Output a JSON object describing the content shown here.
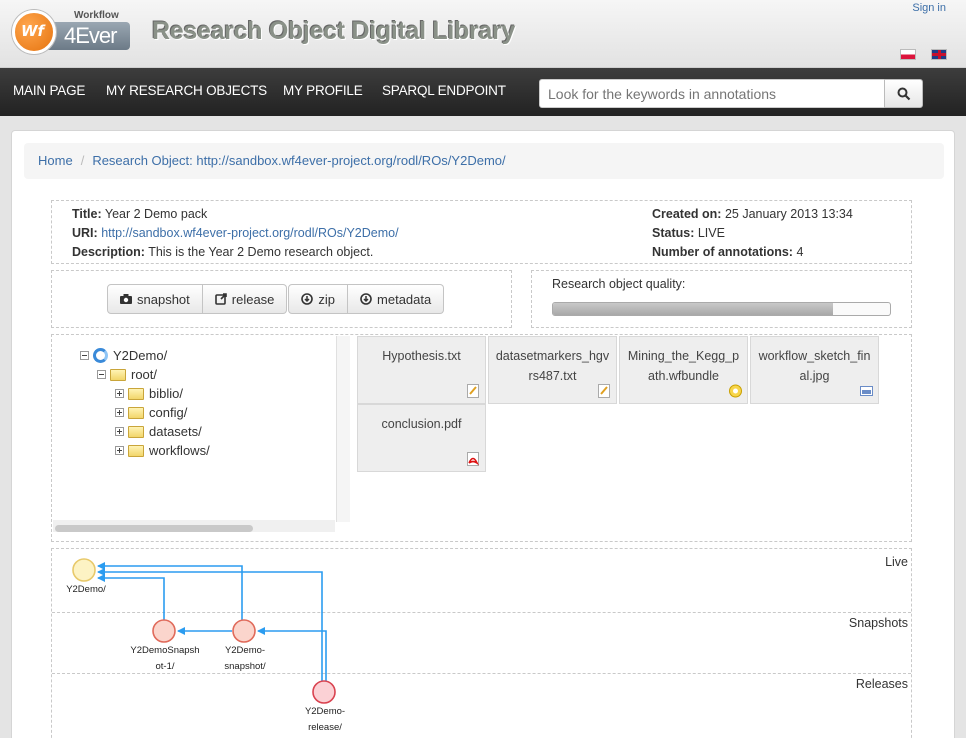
{
  "header": {
    "logo_workflow": "Workflow",
    "logo_wf": "Wf",
    "logo_4ever": "4Ever",
    "site_title": "Research Object Digital Library",
    "sign_in": "Sign in"
  },
  "nav": {
    "items": [
      "MAIN PAGE",
      "MY RESEARCH OBJECTS",
      "MY PROFILE",
      "SPARQL ENDPOINT"
    ],
    "search_placeholder": "Look for the keywords in annotations"
  },
  "breadcrumb": {
    "home": "Home",
    "current": "Research Object: http://sandbox.wf4ever-project.org/rodl/ROs/Y2Demo/"
  },
  "ro": {
    "title_label": "Title:",
    "title": "Year 2 Demo pack",
    "uri_label": "URI:",
    "uri": "http://sandbox.wf4ever-project.org/rodl/ROs/Y2Demo/",
    "description_label": "Description:",
    "description": "This is the Year 2 Demo research object.",
    "created_label": "Created on:",
    "created": "25 January 2013 13:34",
    "status_label": "Status:",
    "status": "LIVE",
    "annotations_label": "Number of annotations:",
    "annotations": "4"
  },
  "actions": {
    "snapshot": "snapshot",
    "release": "release",
    "zip": "zip",
    "metadata": "metadata"
  },
  "quality": {
    "label": "Research object quality:",
    "value_pct": 83
  },
  "tree": {
    "root": "Y2Demo/",
    "child": "root/",
    "folders": [
      "biblio/",
      "config/",
      "datasets/",
      "workflows/"
    ]
  },
  "files": [
    {
      "line1": "Hypothesis.txt",
      "line2": "",
      "icon": "text-file-icon"
    },
    {
      "line1": "datasetmarkers_hgv",
      "line2": "rs487.txt",
      "icon": "text-file-icon"
    },
    {
      "line1": "Mining_the_Kegg_p",
      "line2": "ath.wfbundle",
      "icon": "workflow-bundle-icon"
    },
    {
      "line1": "workflow_sketch_fin",
      "line2": "al.jpg",
      "icon": "image-file-icon"
    },
    {
      "line1": "conclusion.pdf",
      "line2": "",
      "icon": "pdf-file-icon"
    }
  ],
  "history": {
    "lanes": [
      "Live",
      "Snapshots",
      "Releases"
    ],
    "nodes": {
      "live": "Y2Demo/",
      "snap1_a": "Y2DemoSnapsh",
      "snap1_b": "ot-1/",
      "snap2_a": "Y2Demo-",
      "snap2_b": "snapshot/",
      "rel_a": "Y2Demo-",
      "rel_b": "release/"
    },
    "colors": {
      "live_fill": "#fdf3c4",
      "live_stroke": "#e8c96a",
      "snapshot_fill": "#fbd5cc",
      "snapshot_stroke": "#e06a5a",
      "release_fill": "#fbd1d5",
      "release_stroke": "#d9424f",
      "arrow": "#2b9cf0"
    }
  }
}
